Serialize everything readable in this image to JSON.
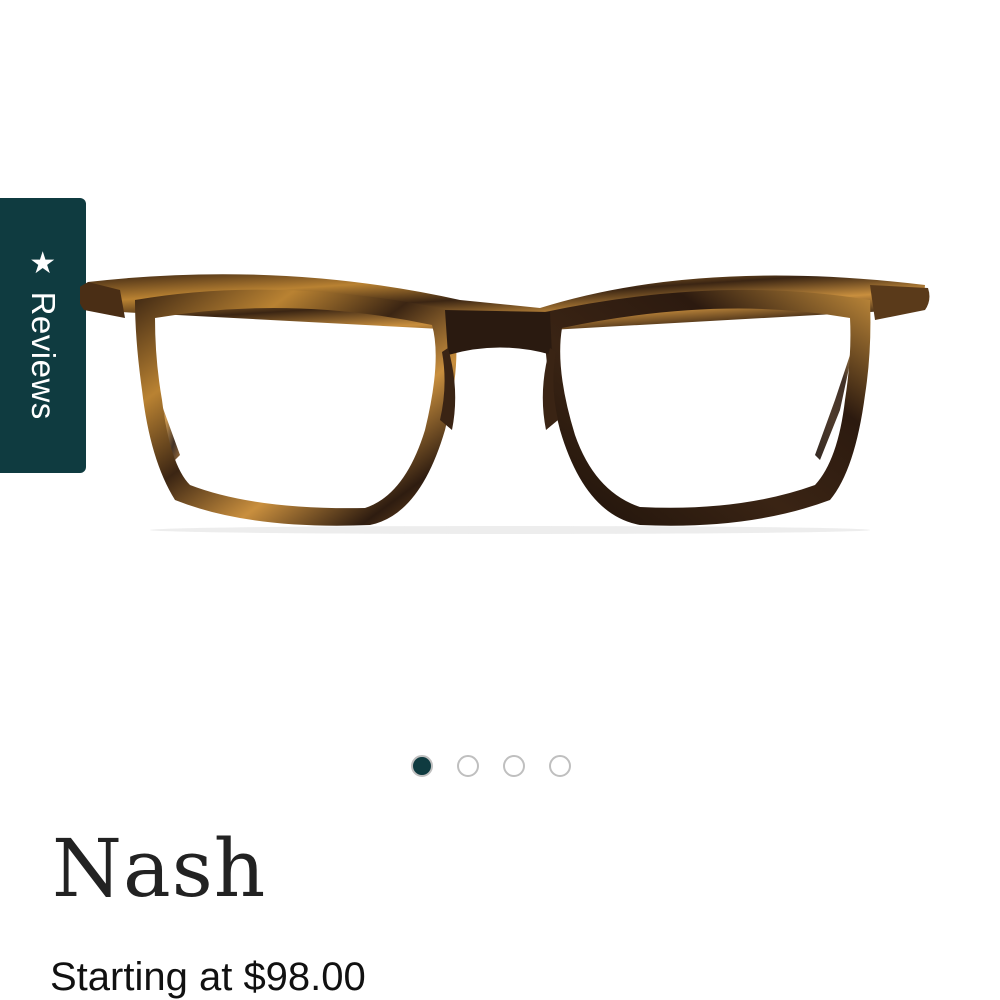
{
  "reviews_tab": {
    "label": "Reviews",
    "icon": "star-icon",
    "background": "#0f3b40"
  },
  "gallery": {
    "image_alt": "tortoise-eyeglasses",
    "slide_count": 4,
    "active_slide": 1,
    "active_dot_color": "#0f3b40"
  },
  "product": {
    "name": "Nash",
    "price_text": "Starting at $98.00"
  },
  "colors": {
    "tortoise_dark": "#2a1a10",
    "tortoise_light": "#b98232"
  }
}
